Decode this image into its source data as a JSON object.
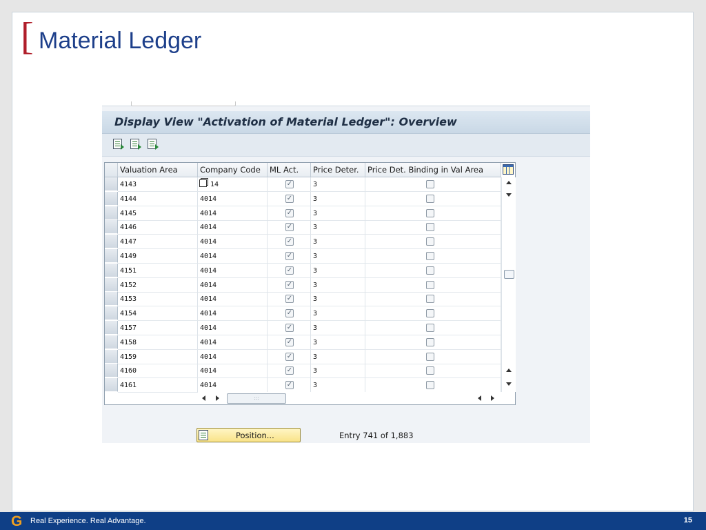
{
  "slide": {
    "bracket": "[",
    "title": "Material Ledger"
  },
  "sap": {
    "screen_title": "Display View \"Activation of Material Ledger\": Overview",
    "toolbar_icons": [
      "details-icon",
      "previous-entry-icon",
      "next-entry-icon"
    ],
    "table": {
      "columns": [
        "Valuation Area",
        "Company Code",
        "ML Act.",
        "Price Deter.",
        "Price Det. Binding in Val Area"
      ],
      "rows": [
        {
          "valuation_area": "4143",
          "company_code": "14",
          "ml_act": true,
          "price_deter": "3",
          "binding": false
        },
        {
          "valuation_area": "4144",
          "company_code": "4014",
          "ml_act": true,
          "price_deter": "3",
          "binding": false
        },
        {
          "valuation_area": "4145",
          "company_code": "4014",
          "ml_act": true,
          "price_deter": "3",
          "binding": false
        },
        {
          "valuation_area": "4146",
          "company_code": "4014",
          "ml_act": true,
          "price_deter": "3",
          "binding": false
        },
        {
          "valuation_area": "4147",
          "company_code": "4014",
          "ml_act": true,
          "price_deter": "3",
          "binding": false
        },
        {
          "valuation_area": "4149",
          "company_code": "4014",
          "ml_act": true,
          "price_deter": "3",
          "binding": false
        },
        {
          "valuation_area": "4151",
          "company_code": "4014",
          "ml_act": true,
          "price_deter": "3",
          "binding": false
        },
        {
          "valuation_area": "4152",
          "company_code": "4014",
          "ml_act": true,
          "price_deter": "3",
          "binding": false
        },
        {
          "valuation_area": "4153",
          "company_code": "4014",
          "ml_act": true,
          "price_deter": "3",
          "binding": false
        },
        {
          "valuation_area": "4154",
          "company_code": "4014",
          "ml_act": true,
          "price_deter": "3",
          "binding": false
        },
        {
          "valuation_area": "4157",
          "company_code": "4014",
          "ml_act": true,
          "price_deter": "3",
          "binding": false
        },
        {
          "valuation_area": "4158",
          "company_code": "4014",
          "ml_act": true,
          "price_deter": "3",
          "binding": false
        },
        {
          "valuation_area": "4159",
          "company_code": "4014",
          "ml_act": true,
          "price_deter": "3",
          "binding": false
        },
        {
          "valuation_area": "4160",
          "company_code": "4014",
          "ml_act": true,
          "price_deter": "3",
          "binding": false
        },
        {
          "valuation_area": "4161",
          "company_code": "4014",
          "ml_act": true,
          "price_deter": "3",
          "binding": false
        }
      ]
    },
    "position_button": "Position...",
    "entry_text": "Entry 741 of 1,883",
    "colors": {
      "header_blue": "#c9d8e6",
      "button_yellow": "#f9e388",
      "checkbox_check": "#5d6a78"
    }
  },
  "footer": {
    "logo_letter": "G",
    "tagline": "Real Experience. Real Advantage.",
    "page_number": "15",
    "colors": {
      "bar": "#0f3f86",
      "logo": "#f0a020"
    }
  }
}
